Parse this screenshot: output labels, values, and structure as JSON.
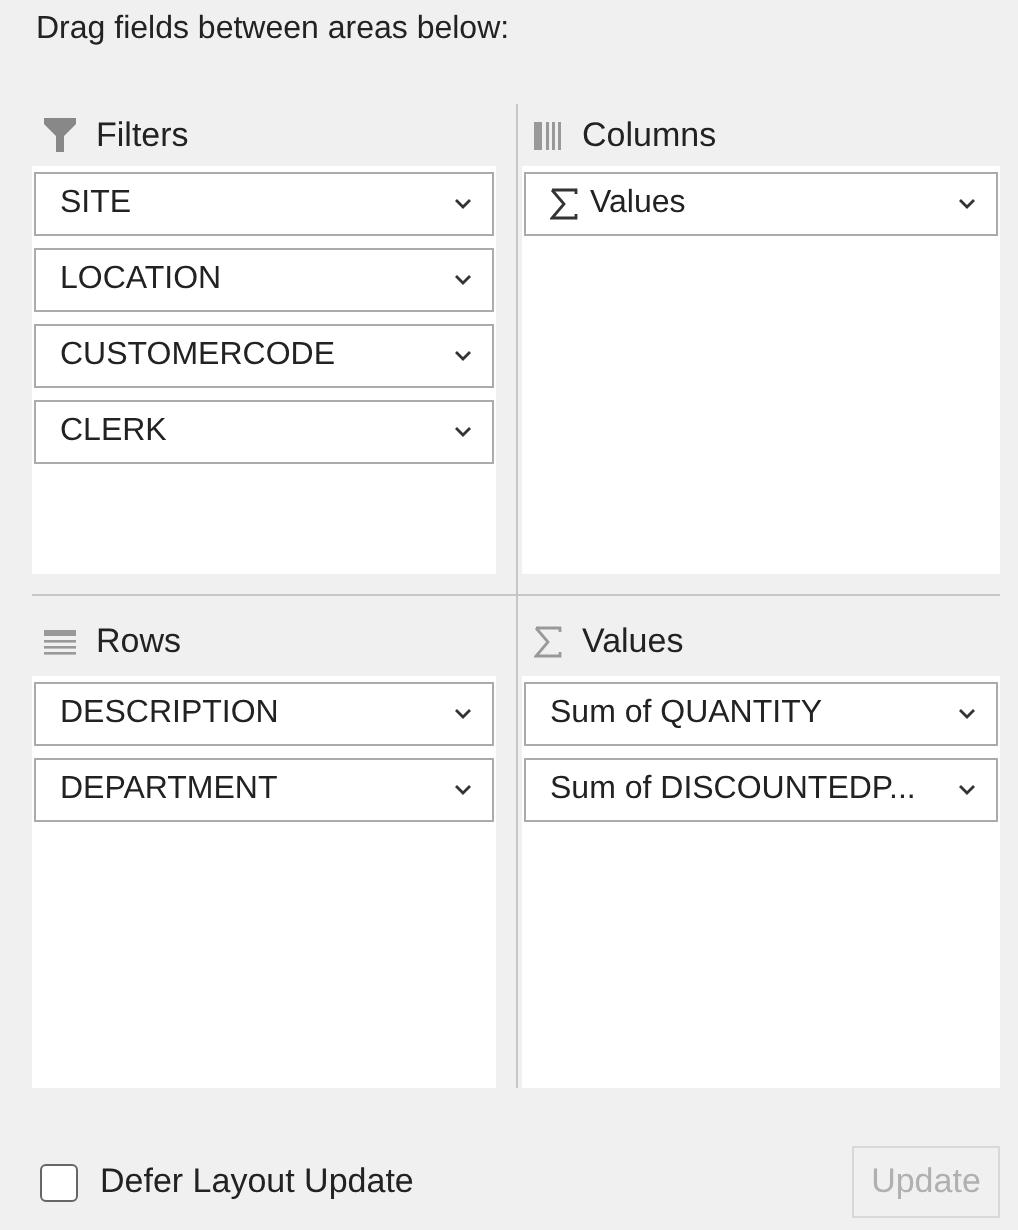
{
  "instruction": "Drag fields between areas below:",
  "areas": [
    {
      "kind": "filters",
      "title": "Filters",
      "fields": [
        {
          "kind": "field",
          "label": "SITE"
        },
        {
          "kind": "field",
          "label": "LOCATION"
        },
        {
          "kind": "field",
          "label": "CUSTOMERCODE"
        },
        {
          "kind": "field",
          "label": "CLERK"
        }
      ]
    },
    {
      "kind": "columns",
      "title": "Columns",
      "fields": [
        {
          "kind": "values",
          "label": "Values"
        }
      ]
    },
    {
      "kind": "rows",
      "title": "Rows",
      "fields": [
        {
          "kind": "field",
          "label": "DESCRIPTION"
        },
        {
          "kind": "field",
          "label": "DEPARTMENT"
        }
      ]
    },
    {
      "kind": "values",
      "title": "Values",
      "fields": [
        {
          "kind": "field",
          "label": "Sum of QUANTITY"
        },
        {
          "kind": "field",
          "label": "Sum of DISCOUNTEDP..."
        }
      ]
    }
  ],
  "defer_update": {
    "label": "Defer Layout Update",
    "checked": false
  },
  "update_button": {
    "label": "Update",
    "disabled": true
  }
}
